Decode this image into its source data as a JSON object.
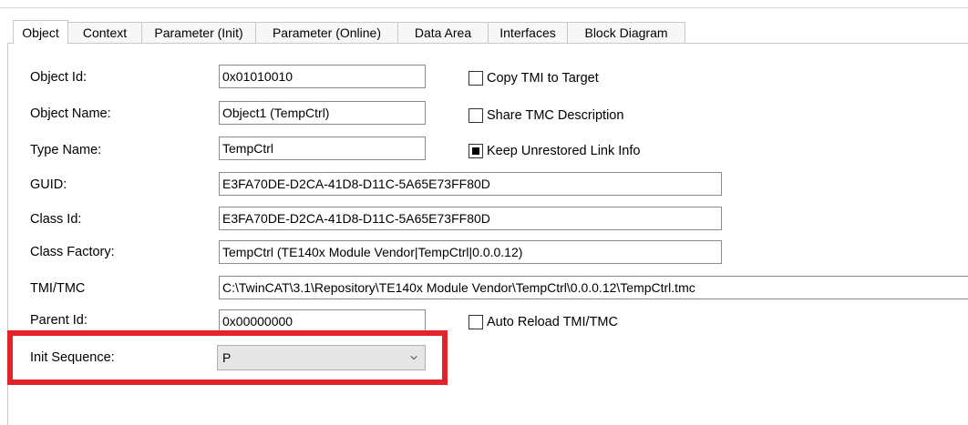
{
  "tabs": [
    {
      "label": "Object",
      "active": true
    },
    {
      "label": "Context"
    },
    {
      "label": "Parameter (Init)"
    },
    {
      "label": "Parameter (Online)"
    },
    {
      "label": "Data Area"
    },
    {
      "label": "Interfaces"
    },
    {
      "label": "Block Diagram"
    }
  ],
  "form": {
    "object_id": {
      "label": "Object Id:",
      "value": "0x01010010"
    },
    "object_name": {
      "label": "Object Name:",
      "value": "Object1 (TempCtrl)"
    },
    "type_name": {
      "label": "Type Name:",
      "value": "TempCtrl"
    },
    "guid": {
      "label": "GUID:",
      "value": "E3FA70DE-D2CA-41D8-D11C-5A65E73FF80D"
    },
    "class_id": {
      "label": "Class Id:",
      "value": "E3FA70DE-D2CA-41D8-D11C-5A65E73FF80D"
    },
    "class_factory": {
      "label": "Class Factory:",
      "value": "TempCtrl (TE140x Module Vendor|TempCtrl|0.0.0.12)"
    },
    "tmi_tmc": {
      "label": "TMI/TMC",
      "value": "C:\\TwinCAT\\3.1\\Repository\\TE140x Module Vendor\\TempCtrl\\0.0.0.12\\TempCtrl.tmc"
    },
    "parent_id": {
      "label": "Parent Id:",
      "value": "0x00000000"
    },
    "init_sequence": {
      "label": "Init Sequence:",
      "value": "P"
    }
  },
  "checkboxes": {
    "copy_tmi": {
      "label": "Copy TMI to Target",
      "checked": false
    },
    "share_tmc": {
      "label": "Share TMC Description",
      "checked": false
    },
    "keep_link": {
      "label": "Keep Unrestored Link Info",
      "checked": true
    },
    "auto_reload": {
      "label": "Auto Reload TMI/TMC",
      "checked": false
    }
  },
  "colors": {
    "highlight": "#e3222a"
  },
  "icons": {
    "dropdown": "chevron-down-icon"
  }
}
